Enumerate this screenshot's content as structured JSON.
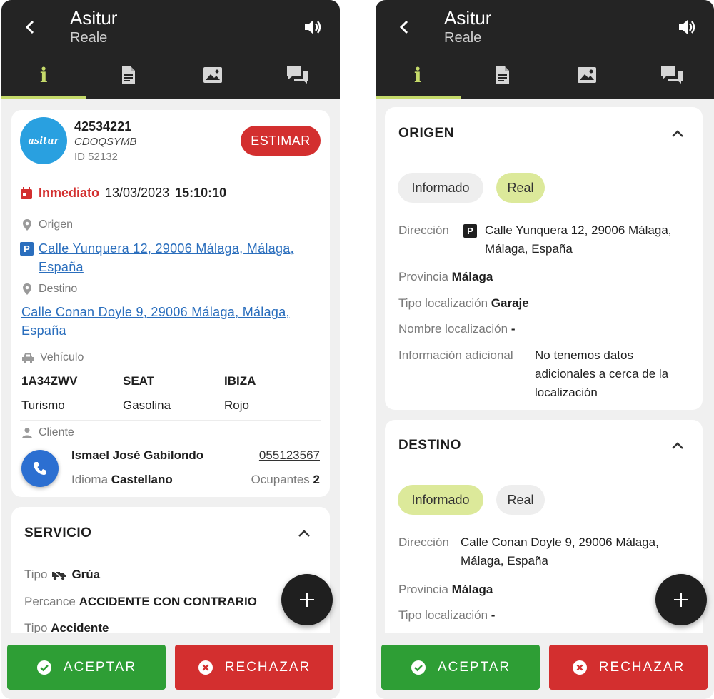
{
  "colors": {
    "appbar": "#242424",
    "accent": "#c5da6a",
    "accept": "#2e9e35",
    "reject": "#d32f2f",
    "link": "#2a6ebd",
    "estimar": "#d32f2f"
  },
  "appbar": {
    "title": "Asitur",
    "subtitle": "Reale"
  },
  "tabs": [
    {
      "icon": "info-icon",
      "label": "i",
      "active": true
    },
    {
      "icon": "document-icon",
      "active": false
    },
    {
      "icon": "image-icon",
      "active": false
    },
    {
      "icon": "chat-icon",
      "active": false
    }
  ],
  "left": {
    "header": {
      "logo_text": "asitur",
      "number": "42534221",
      "code": "CDOQSYMB",
      "id": "ID 52132",
      "estimar_label": "ESTIMAR"
    },
    "schedule": {
      "label": "Inmediato",
      "date": "13/03/2023",
      "time": "15:10:10"
    },
    "origen": {
      "label": "Origen",
      "badge": "P",
      "address": "Calle Yunquera 12, 29006 Málaga, Málaga, España"
    },
    "destino": {
      "label": "Destino",
      "address": "Calle Conan Doyle 9, 29006 Málaga, Málaga, España"
    },
    "vehiculo": {
      "label": "Vehículo",
      "plate": "1A34ZWV",
      "brand": "SEAT",
      "model": "IBIZA",
      "type": "Turismo",
      "fuel": "Gasolina",
      "color": "Rojo"
    },
    "cliente": {
      "label": "Cliente",
      "name": "Ismael José Gabilondo",
      "phone": "055123567",
      "idioma_label": "Idioma",
      "idioma": "Castellano",
      "ocupantes_label": "Ocupantes",
      "ocupantes": "2"
    },
    "servicio": {
      "title": "SERVICIO",
      "tipo_label": "Tipo",
      "tipo": "Grúa",
      "percance_label": "Percance",
      "percance": "ACCIDENTE CON CONTRARIO",
      "tipo2_label": "Tipo",
      "tipo2": "Accidente"
    }
  },
  "right": {
    "origen": {
      "title": "ORIGEN",
      "chips": [
        "Informado",
        "Real"
      ],
      "selected": "Real",
      "direccion_label": "Dirección",
      "badge": "P",
      "direccion": "Calle Yunquera 12, 29006 Málaga, Málaga, España",
      "provincia_label": "Provincia",
      "provincia": "Málaga",
      "tipo_label": "Tipo localización",
      "tipo": "Garaje",
      "nombre_label": "Nombre localización",
      "nombre": "-",
      "info_label": "Información adicional",
      "info": "No tenemos datos adicionales a cerca de la localización"
    },
    "destino": {
      "title": "DESTINO",
      "chips": [
        "Informado",
        "Real"
      ],
      "selected": "Informado",
      "direccion_label": "Dirección",
      "direccion": "Calle Conan Doyle 9, 29006 Málaga, Málaga, España",
      "provincia_label": "Provincia",
      "provincia": "Málaga",
      "tipo_label": "Tipo localización",
      "tipo": "-"
    }
  },
  "footer": {
    "accept_label": "ACEPTAR",
    "reject_label": "RECHAZAR"
  }
}
